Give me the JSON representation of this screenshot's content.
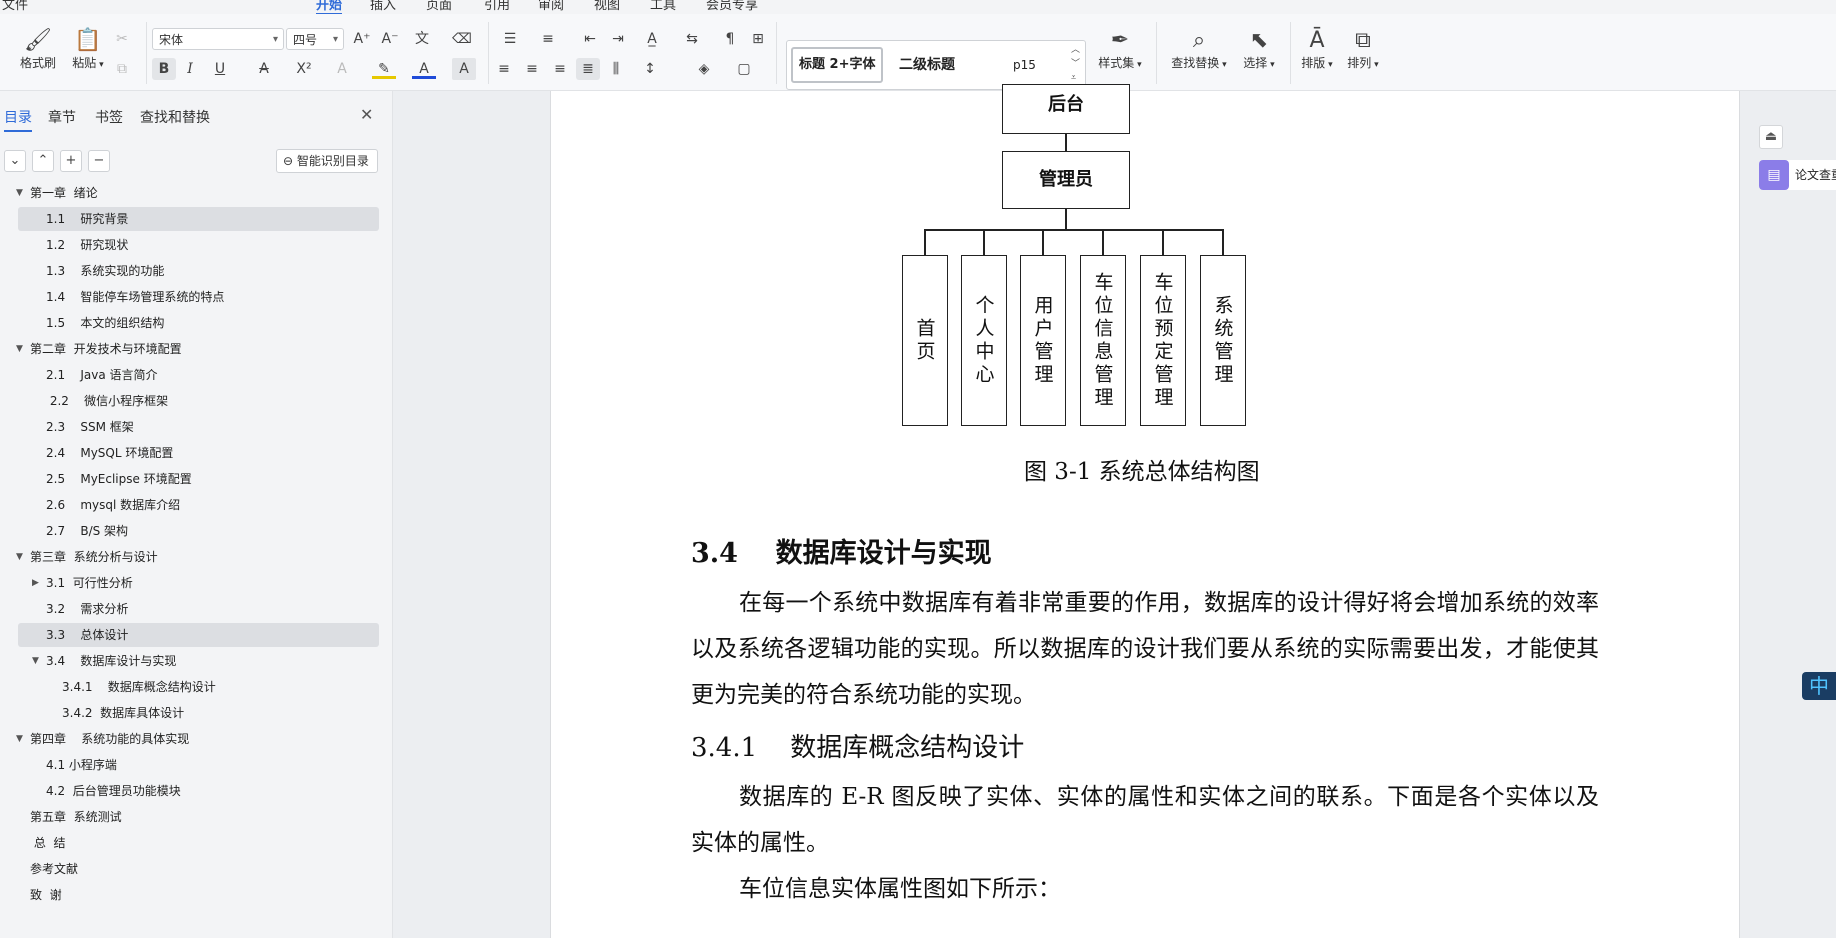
{
  "menubar": {
    "items": [
      "文件",
      "开始",
      "插入",
      "页面",
      "引用",
      "审阅",
      "视图",
      "工具",
      "会员专享"
    ],
    "active": "开始"
  },
  "ribbon": {
    "format_painter": "格式刷",
    "paste": "粘贴",
    "font_name": "宋体",
    "font_size": "四号",
    "style_1": "标题 2+字体",
    "style_2": "二级标题",
    "style_3": "p15",
    "style_set": "样式集",
    "find_replace": "查找替换",
    "select": "选择",
    "layout": "排版",
    "arrange": "排列",
    "bold": "B",
    "italic": "I",
    "underline": "U"
  },
  "nav_pane": {
    "tabs": [
      "目录",
      "章节",
      "书签",
      "查找和替换"
    ],
    "active_tab": "目录",
    "smart_toc_button": "智能识别目录",
    "toc": [
      {
        "text": "第一章  绪论",
        "level": 0,
        "expanded": true
      },
      {
        "text": "1.1    研究背景",
        "level": 1,
        "highlight": true
      },
      {
        "text": "1.2    研究现状",
        "level": 1
      },
      {
        "text": "1.3    系统实现的功能",
        "level": 1
      },
      {
        "text": "1.4    智能停车场管理系统的特点",
        "level": 1
      },
      {
        "text": "1.5    本文的组织结构",
        "level": 1
      },
      {
        "text": "第二章  开发技术与环境配置",
        "level": 0,
        "expanded": true
      },
      {
        "text": "2.1    Java 语言简介",
        "level": 1
      },
      {
        "text": " 2.2    微信小程序框架",
        "level": 1
      },
      {
        "text": "2.3    SSM 框架",
        "level": 1
      },
      {
        "text": "2.4    MySQL 环境配置",
        "level": 1
      },
      {
        "text": "2.5    MyEclipse 环境配置",
        "level": 1
      },
      {
        "text": "2.6    mysql 数据库介绍",
        "level": 1
      },
      {
        "text": "2.7    B/S 架构",
        "level": 1
      },
      {
        "text": "第三章  系统分析与设计",
        "level": 0,
        "expanded": true
      },
      {
        "text": "3.1  可行性分析",
        "level": 1,
        "collapsed": true
      },
      {
        "text": "3.2    需求分析",
        "level": 1
      },
      {
        "text": "3.3    总体设计",
        "level": 1,
        "highlight": true
      },
      {
        "text": "3.4    数据库设计与实现",
        "level": 1,
        "expanded": true
      },
      {
        "text": "3.4.1    数据库概念结构设计",
        "level": 2
      },
      {
        "text": "3.4.2  数据库具体设计",
        "level": 2
      },
      {
        "text": "第四章    系统功能的具体实现",
        "level": 0,
        "expanded": true
      },
      {
        "text": "4.1 小程序端",
        "level": 1
      },
      {
        "text": "4.2  后台管理员功能模块",
        "level": 1
      },
      {
        "text": "第五章  系统测试",
        "level": 0
      },
      {
        "text": " 总  结",
        "level": 0
      },
      {
        "text": "参考文献",
        "level": 0
      },
      {
        "text": "致  谢",
        "level": 0
      }
    ]
  },
  "document": {
    "diagram": {
      "top_node": "后台",
      "admin_node": "管理员",
      "children": [
        "首页",
        "个人中心",
        "用户管理",
        "车位信息管理",
        "车位预定管理",
        "系统管理"
      ]
    },
    "figure_caption": "图 3-1  系统总体结构图",
    "heading_34": "3.4    数据库设计与实现",
    "para_1": "在每一个系统中数据库有着非常重要的作用，数据库的设计得好将会增加系统的效率以及系统各逻辑功能的实现。所以数据库的设计我们要从系统的实际需要出发，才能使其更为完美的符合系统功能的实现。",
    "heading_341": "3.4.1    数据库概念结构设计",
    "para_2": "数据库的 E-R 图反映了实体、实体的属性和实体之间的联系。下面是各个实体以及实体的属性。",
    "para_3": "车位信息实体属性图如下所示："
  },
  "right_panel": {
    "paper_check": "论文查重",
    "ime": "中"
  }
}
